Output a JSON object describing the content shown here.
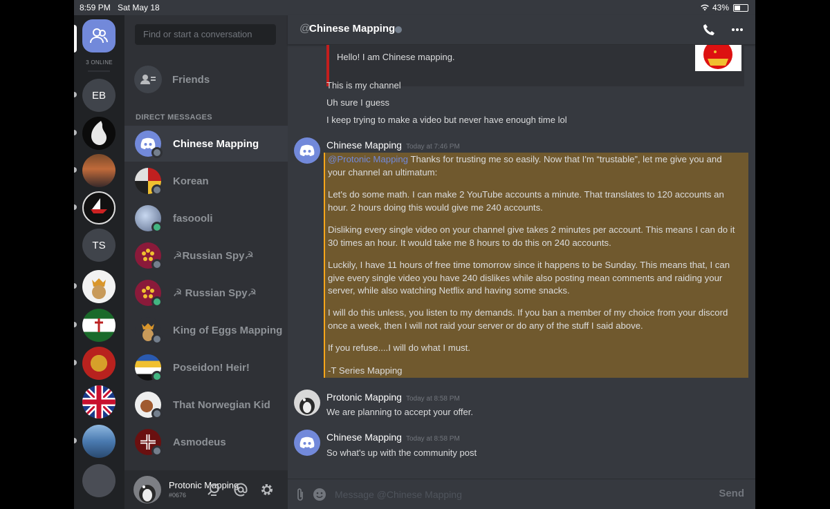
{
  "statusbar": {
    "time": "8:59 PM",
    "date": "Sat May 18",
    "battery": "43%"
  },
  "guilds": {
    "online_count": "3 ONLINE",
    "eb_label": "EB",
    "ts_label": "TS"
  },
  "search": {
    "placeholder": "Find or start a conversation"
  },
  "friends": {
    "label": "Friends"
  },
  "direct_messages": {
    "header": "DIRECT MESSAGES",
    "items": [
      {
        "name": "Chinese Mapping",
        "status": "offline",
        "active": true
      },
      {
        "name": "Korean",
        "status": "offline"
      },
      {
        "name": "fasoooli",
        "status": "online"
      },
      {
        "name": "☭Russian Spy☭",
        "status": "offline"
      },
      {
        "name": "☭ Russian Spy☭",
        "status": "online"
      },
      {
        "name": "King of Eggs Mapping",
        "status": "offline"
      },
      {
        "name": "Poseidon! Heir!",
        "status": "online"
      },
      {
        "name": "That Norwegian Kid",
        "status": "offline"
      },
      {
        "name": "Asmodeus",
        "status": "offline"
      }
    ]
  },
  "user_panel": {
    "username": "Protonic Mapping",
    "tag": "#0676"
  },
  "chat": {
    "at": "@",
    "title": "Chinese Mapping",
    "embed_desc": "Hello! I am Chinese mapping.",
    "early_lines": [
      "This is my channel",
      "Uh sure I guess",
      "I keep trying to make a video but never have enough time lol"
    ],
    "messages": [
      {
        "author": "Chinese Mapping",
        "timestamp": "Today at 7:46 PM",
        "mention": "@Protonic Mapping",
        "paragraphs": [
          " Thanks for trusting me so easily. Now that I'm “trustable”, let me give you and your channel an ultimatum:",
          "Let's do some math. I can make 2 YouTube accounts a minute. That translates to 120 accounts an hour. 2 hours doing this would give me 240 accounts.",
          "Disliking every single video on your channel give takes 2 minutes per account. This means I can do it 30 times an hour. It would take me 8 hours to do this on 240 accounts.",
          "Luckily, I have 11 hours of free time tomorrow since it happens to be Sunday. This means that, I can give every single video you have 240 dislikes while also posting mean comments and raiding your server, while also watching Netflix and having some snacks.",
          "I will do this unless, you listen to my demands. If you ban a member of my choice from your discord once a week, then I will not raid your server or do any of the stuff I said above.",
          "If you refuse....I will do what I must.",
          "-T Series Mapping"
        ]
      },
      {
        "author": "Protonic Mapping",
        "timestamp": "Today at 8:58 PM",
        "text": "We are planning to accept your offer."
      },
      {
        "author": "Chinese Mapping",
        "timestamp": "Today at 8:58 PM",
        "text": "So what's up with the community post"
      }
    ]
  },
  "composer": {
    "placeholder": "Message @Chinese Mapping",
    "send": "Send"
  },
  "colors": {
    "blurple": "#7289da",
    "online": "#43b581",
    "offline": "#747f8d",
    "highlight": "#70592e",
    "embed_border": "#c41e1e"
  }
}
